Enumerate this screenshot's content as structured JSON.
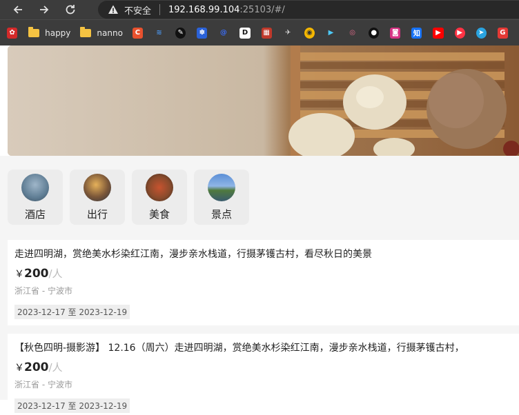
{
  "browser": {
    "security_label": "不安全",
    "url_host": "192.168.99.104",
    "url_rest": ":25103/#/"
  },
  "bookmarks": {
    "folders": [
      {
        "label": "happy"
      },
      {
        "label": "nanno"
      }
    ]
  },
  "categories": [
    {
      "label": "酒店"
    },
    {
      "label": "出行"
    },
    {
      "label": "美食"
    },
    {
      "label": "景点"
    }
  ],
  "listings": [
    {
      "title": "走进四明湖，赏绝美水杉染红江南，漫步亲水栈道，行摄茅镬古村，看尽秋日的美景",
      "currency": "￥",
      "price": "200",
      "per": "/人",
      "location": "浙江省 - 宁波市",
      "dates": "2023-12-17 至 2023-12-19"
    },
    {
      "title": "【秋色四明-摄影游】 12.16（周六）走进四明湖，赏绝美水杉染红江南，漫步亲水栈道，行摄茅镬古村，",
      "currency": "￥",
      "price": "200",
      "per": "/人",
      "location": "浙江省 - 宁波市",
      "dates": "2023-12-17 至 2023-12-19"
    }
  ]
}
